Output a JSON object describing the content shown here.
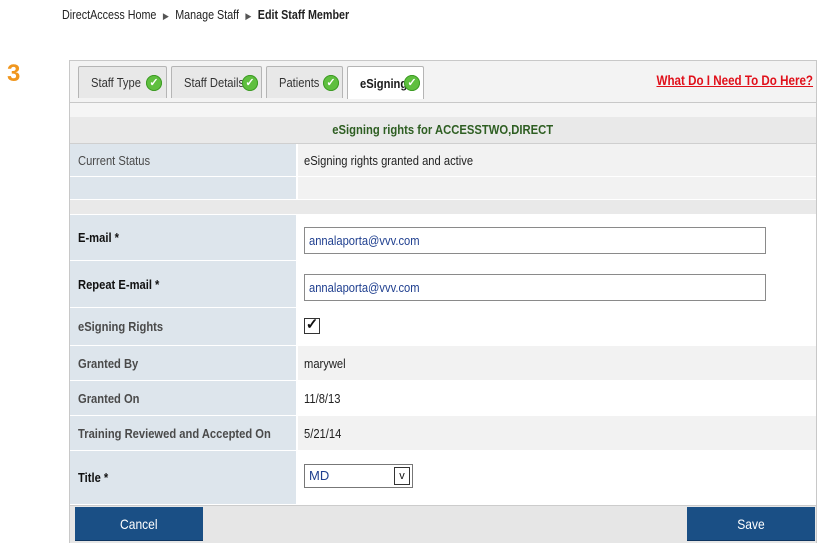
{
  "breadcrumb": {
    "items": [
      "DirectAccess Home",
      "Manage Staff"
    ],
    "current": "Edit Staff Member",
    "separator": "▶"
  },
  "step_number": "3",
  "tabs": [
    {
      "label": "Staff Type",
      "complete": true
    },
    {
      "label": "Staff Details",
      "complete": true
    },
    {
      "label": "Patients",
      "complete": true
    },
    {
      "label": "eSigning",
      "complete": true,
      "active": true
    }
  ],
  "help_link": "What Do I Need To Do Here?",
  "section_title": "eSigning rights for  ACCESSTWO,DIRECT",
  "current_status": {
    "label": "Current Status",
    "value": "eSigning rights granted and active"
  },
  "email": {
    "label": "E-mail *",
    "value": "annalaporta@vvv.com"
  },
  "repeat_email": {
    "label": "Repeat E-mail *",
    "value": "annalaporta@vvv.com"
  },
  "esigning_rights": {
    "label": "eSigning Rights",
    "checked": true,
    "check_glyph": "✓"
  },
  "granted_by": {
    "label": "Granted By",
    "value": "marywel"
  },
  "granted_on": {
    "label": "Granted On",
    "value": "11/8/13"
  },
  "training": {
    "label": "Training Reviewed and Accepted On",
    "value": "5/21/14"
  },
  "title": {
    "label": "Title *",
    "selected": "MD"
  },
  "buttons": {
    "cancel": "Cancel",
    "save": "Save"
  },
  "colors": {
    "accent_step": "#f0961e",
    "help_link": "#e0101a",
    "section_title": "#2e5e22",
    "button": "#1a4f85",
    "label_bg": "#dde5ec",
    "check_green": "#5fbf3f"
  }
}
